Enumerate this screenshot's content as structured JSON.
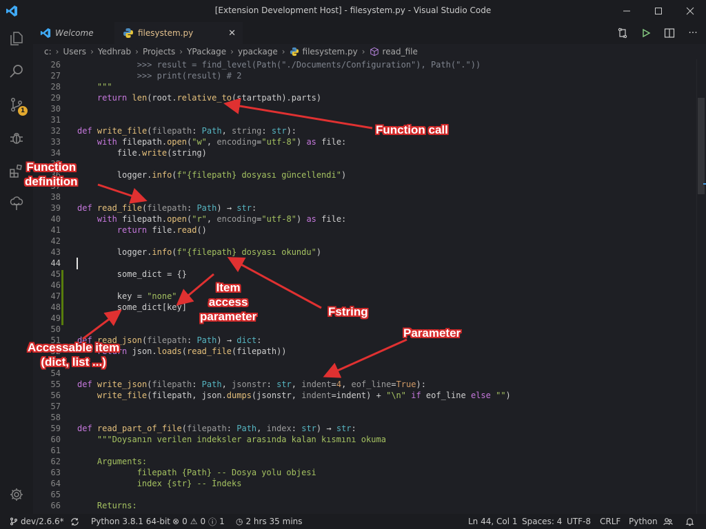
{
  "window": {
    "title": "[Extension Development Host] - filesystem.py - Visual Studio Code",
    "minimize_icon": "minimize-icon",
    "maximize_icon": "maximize-icon",
    "close_icon": "close-icon"
  },
  "tabs": [
    {
      "label": "Welcome",
      "icon": "vscode-icon"
    },
    {
      "label": "filesystem.py",
      "icon": "python-icon"
    }
  ],
  "editor_actions": [
    "compare-changes-icon",
    "run-icon",
    "split-editor-icon",
    "more-actions-icon"
  ],
  "breadcrumb": {
    "parts": [
      "c:",
      "Users",
      "Yedhrab",
      "Projects",
      "YPackage",
      "ypackage",
      "filesystem.py",
      "read_file"
    ]
  },
  "activity": {
    "items": [
      "explorer-icon",
      "search-icon",
      "source-control-icon",
      "debug-icon",
      "extensions-icon",
      "tree-icon"
    ],
    "scm_badge": "1",
    "settings_icon": "gear-icon"
  },
  "code": {
    "current_line": "44",
    "lines": [
      {
        "n": "26",
        "text": "            >>> result = find_level(Path(\"./Documents/Configuration\"), Path(\".\"))"
      },
      {
        "n": "27",
        "text": "            >>> print(result) # 2"
      },
      {
        "n": "28",
        "text": "    \"\"\""
      },
      {
        "n": "29",
        "text": "    return len(root.relative_to(startpath).parts)"
      },
      {
        "n": "30",
        "text": ""
      },
      {
        "n": "31",
        "text": ""
      },
      {
        "n": "32",
        "text": "def write_file(filepath: Path, string: str):"
      },
      {
        "n": "33",
        "text": "    with filepath.open(\"w\", encoding=\"utf-8\") as file:"
      },
      {
        "n": "34",
        "text": "        file.write(string)"
      },
      {
        "n": "35",
        "text": ""
      },
      {
        "n": "36",
        "text": "        logger.info(f\"{filepath} dosyası güncellendi\")"
      },
      {
        "n": "37",
        "text": ""
      },
      {
        "n": "38",
        "text": ""
      },
      {
        "n": "39",
        "text": "def read_file(filepath: Path) → str:"
      },
      {
        "n": "40",
        "text": "    with filepath.open(\"r\", encoding=\"utf-8\") as file:"
      },
      {
        "n": "41",
        "text": "        return file.read()"
      },
      {
        "n": "42",
        "text": ""
      },
      {
        "n": "43",
        "text": "        logger.info(f\"{filepath} dosyası okundu\")"
      },
      {
        "n": "44",
        "text": ""
      },
      {
        "n": "45",
        "text": "        some_dict = {}"
      },
      {
        "n": "46",
        "text": ""
      },
      {
        "n": "47",
        "text": "        key = \"none\""
      },
      {
        "n": "48",
        "text": "        some_dict[key]"
      },
      {
        "n": "49",
        "text": ""
      },
      {
        "n": "50",
        "text": ""
      },
      {
        "n": "51",
        "text": "def read_json(filepath: Path) → dict:"
      },
      {
        "n": "52",
        "text": "    return json.loads(read_file(filepath))"
      },
      {
        "n": "53",
        "text": ""
      },
      {
        "n": "54",
        "text": ""
      },
      {
        "n": "55",
        "text": "def write_json(filepath: Path, jsonstr: str, indent=4, eof_line=True):"
      },
      {
        "n": "56",
        "text": "    write_file(filepath, json.dumps(jsonstr, indent=indent) + \"\\n\" if eof_line else \"\")"
      },
      {
        "n": "57",
        "text": ""
      },
      {
        "n": "58",
        "text": ""
      },
      {
        "n": "59",
        "text": "def read_part_of_file(filepath: Path, index: str) → str:"
      },
      {
        "n": "60",
        "text": "    \"\"\"Doysanın verilen indeksler arasında kalan kısmını okuma"
      },
      {
        "n": "61",
        "text": ""
      },
      {
        "n": "62",
        "text": "    Arguments:"
      },
      {
        "n": "63",
        "text": "            filepath {Path} -- Dosya yolu objesi"
      },
      {
        "n": "64",
        "text": "            index {str} -- İndeks"
      },
      {
        "n": "65",
        "text": ""
      },
      {
        "n": "66",
        "text": "    Returns:"
      }
    ]
  },
  "annotations": {
    "function_call": "Function call",
    "function_definition": "Function\ndefinition",
    "item_access": "Item\naccess\nparameter",
    "fstring": "Fstring",
    "parameter": "Parameter",
    "accessable_item": "Accessable item\n(dict, list ...)",
    "arrow_color": "#e03131"
  },
  "status": {
    "branch": "dev/2.6.6*",
    "sync_icon": "sync-icon",
    "python": "Python 3.8.1 64-bit",
    "errors": "0",
    "warnings": "0",
    "info": "1",
    "time": "2 hrs 35 mins",
    "cursor": "Ln 44, Col 1",
    "spaces": "Spaces: 4",
    "encoding": "UTF-8",
    "eol": "CRLF",
    "language": "Python"
  },
  "colors": {
    "keyword": "#c678dd",
    "function": "#e5c07b",
    "string": "#a5c261",
    "number": "#d19a66",
    "type": "#56b6c2",
    "background": "#1e1f24"
  }
}
